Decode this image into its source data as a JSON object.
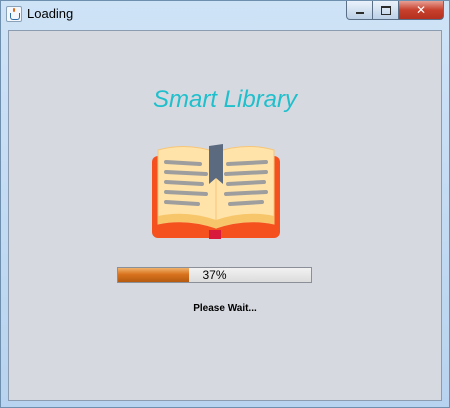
{
  "window": {
    "title": "Loading",
    "controls": {
      "minimize_icon": "minimize-icon",
      "maximize_icon": "maximize-icon",
      "close_icon": "close-icon"
    }
  },
  "splash": {
    "app_title": "Smart Library",
    "app_title_color": "#20bfcc",
    "logo_icon": "open-book-icon",
    "progress": {
      "value_percent": 37,
      "label": "37%",
      "fill_color": "#d9731e"
    },
    "status_text": "Please Wait..."
  }
}
